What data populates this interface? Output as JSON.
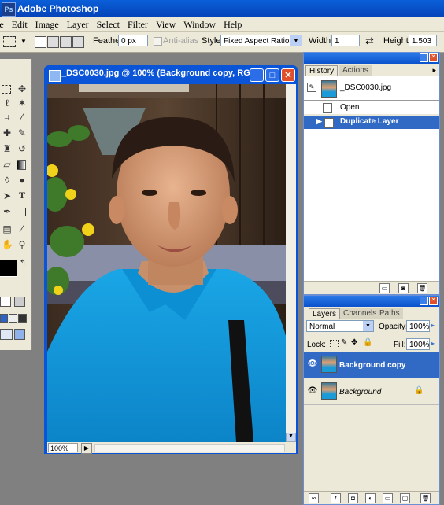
{
  "app": {
    "title": "Adobe Photoshop",
    "icon": "ps-logo-icon"
  },
  "menu": [
    "le",
    "Edit",
    "Image",
    "Layer",
    "Select",
    "Filter",
    "View",
    "Window",
    "Help"
  ],
  "options": {
    "feather_label": "Feather:",
    "feather_value": "0 px",
    "antialias_label": "Anti-alias",
    "style_label": "Style:",
    "style_value": "Fixed Aspect Ratio",
    "width_label": "Width:",
    "width_value": "1",
    "height_label": "Height:",
    "height_value": "1.503"
  },
  "document": {
    "title": "_DSC0030.jpg @ 100% (Background copy, RG...",
    "zoom": "100%"
  },
  "history": {
    "tabs": [
      "History",
      "Actions"
    ],
    "snapshot": "_DSC0030.jpg",
    "states": [
      "Open",
      "Duplicate Layer"
    ],
    "selected_state": "Duplicate Layer"
  },
  "layers": {
    "tabs": [
      "Layers",
      "Channels",
      "Paths"
    ],
    "blend_mode": "Normal",
    "opacity_label": "Opacity:",
    "opacity_value": "100%",
    "lock_label": "Lock:",
    "fill_label": "Fill:",
    "fill_value": "100%",
    "items": [
      "Background copy",
      "Background"
    ],
    "selected": "Background copy"
  },
  "colors": {
    "titlebar": "#0a55d5",
    "chrome": "#ece9d8",
    "selection": "#316ac5",
    "workspace": "#808080"
  }
}
